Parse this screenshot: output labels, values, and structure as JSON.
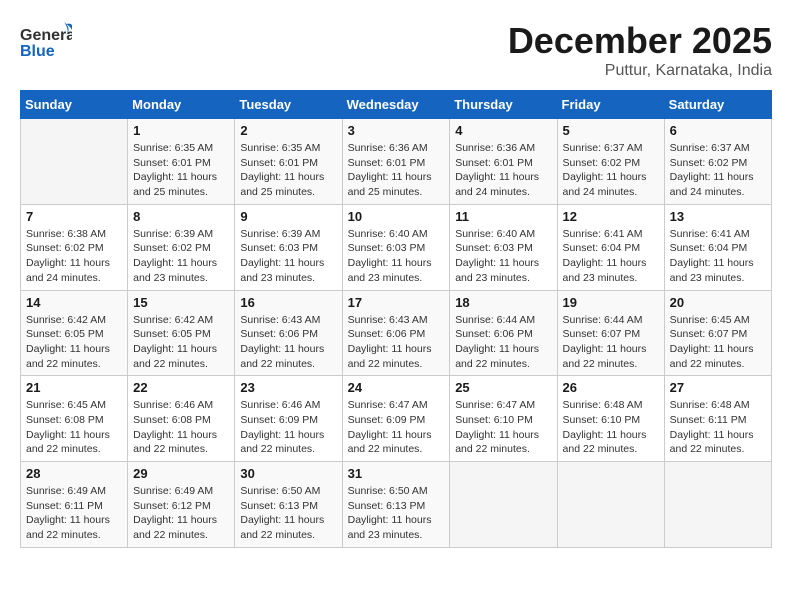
{
  "header": {
    "logo_general": "General",
    "logo_blue": "Blue",
    "month": "December 2025",
    "location": "Puttur, Karnataka, India"
  },
  "calendar": {
    "days_of_week": [
      "Sunday",
      "Monday",
      "Tuesday",
      "Wednesday",
      "Thursday",
      "Friday",
      "Saturday"
    ],
    "weeks": [
      [
        {
          "day": "",
          "info": ""
        },
        {
          "day": "1",
          "info": "Sunrise: 6:35 AM\nSunset: 6:01 PM\nDaylight: 11 hours\nand 25 minutes."
        },
        {
          "day": "2",
          "info": "Sunrise: 6:35 AM\nSunset: 6:01 PM\nDaylight: 11 hours\nand 25 minutes."
        },
        {
          "day": "3",
          "info": "Sunrise: 6:36 AM\nSunset: 6:01 PM\nDaylight: 11 hours\nand 25 minutes."
        },
        {
          "day": "4",
          "info": "Sunrise: 6:36 AM\nSunset: 6:01 PM\nDaylight: 11 hours\nand 24 minutes."
        },
        {
          "day": "5",
          "info": "Sunrise: 6:37 AM\nSunset: 6:02 PM\nDaylight: 11 hours\nand 24 minutes."
        },
        {
          "day": "6",
          "info": "Sunrise: 6:37 AM\nSunset: 6:02 PM\nDaylight: 11 hours\nand 24 minutes."
        }
      ],
      [
        {
          "day": "7",
          "info": "Sunrise: 6:38 AM\nSunset: 6:02 PM\nDaylight: 11 hours\nand 24 minutes."
        },
        {
          "day": "8",
          "info": "Sunrise: 6:39 AM\nSunset: 6:02 PM\nDaylight: 11 hours\nand 23 minutes."
        },
        {
          "day": "9",
          "info": "Sunrise: 6:39 AM\nSunset: 6:03 PM\nDaylight: 11 hours\nand 23 minutes."
        },
        {
          "day": "10",
          "info": "Sunrise: 6:40 AM\nSunset: 6:03 PM\nDaylight: 11 hours\nand 23 minutes."
        },
        {
          "day": "11",
          "info": "Sunrise: 6:40 AM\nSunset: 6:03 PM\nDaylight: 11 hours\nand 23 minutes."
        },
        {
          "day": "12",
          "info": "Sunrise: 6:41 AM\nSunset: 6:04 PM\nDaylight: 11 hours\nand 23 minutes."
        },
        {
          "day": "13",
          "info": "Sunrise: 6:41 AM\nSunset: 6:04 PM\nDaylight: 11 hours\nand 23 minutes."
        }
      ],
      [
        {
          "day": "14",
          "info": "Sunrise: 6:42 AM\nSunset: 6:05 PM\nDaylight: 11 hours\nand 22 minutes."
        },
        {
          "day": "15",
          "info": "Sunrise: 6:42 AM\nSunset: 6:05 PM\nDaylight: 11 hours\nand 22 minutes."
        },
        {
          "day": "16",
          "info": "Sunrise: 6:43 AM\nSunset: 6:06 PM\nDaylight: 11 hours\nand 22 minutes."
        },
        {
          "day": "17",
          "info": "Sunrise: 6:43 AM\nSunset: 6:06 PM\nDaylight: 11 hours\nand 22 minutes."
        },
        {
          "day": "18",
          "info": "Sunrise: 6:44 AM\nSunset: 6:06 PM\nDaylight: 11 hours\nand 22 minutes."
        },
        {
          "day": "19",
          "info": "Sunrise: 6:44 AM\nSunset: 6:07 PM\nDaylight: 11 hours\nand 22 minutes."
        },
        {
          "day": "20",
          "info": "Sunrise: 6:45 AM\nSunset: 6:07 PM\nDaylight: 11 hours\nand 22 minutes."
        }
      ],
      [
        {
          "day": "21",
          "info": "Sunrise: 6:45 AM\nSunset: 6:08 PM\nDaylight: 11 hours\nand 22 minutes."
        },
        {
          "day": "22",
          "info": "Sunrise: 6:46 AM\nSunset: 6:08 PM\nDaylight: 11 hours\nand 22 minutes."
        },
        {
          "day": "23",
          "info": "Sunrise: 6:46 AM\nSunset: 6:09 PM\nDaylight: 11 hours\nand 22 minutes."
        },
        {
          "day": "24",
          "info": "Sunrise: 6:47 AM\nSunset: 6:09 PM\nDaylight: 11 hours\nand 22 minutes."
        },
        {
          "day": "25",
          "info": "Sunrise: 6:47 AM\nSunset: 6:10 PM\nDaylight: 11 hours\nand 22 minutes."
        },
        {
          "day": "26",
          "info": "Sunrise: 6:48 AM\nSunset: 6:10 PM\nDaylight: 11 hours\nand 22 minutes."
        },
        {
          "day": "27",
          "info": "Sunrise: 6:48 AM\nSunset: 6:11 PM\nDaylight: 11 hours\nand 22 minutes."
        }
      ],
      [
        {
          "day": "28",
          "info": "Sunrise: 6:49 AM\nSunset: 6:11 PM\nDaylight: 11 hours\nand 22 minutes."
        },
        {
          "day": "29",
          "info": "Sunrise: 6:49 AM\nSunset: 6:12 PM\nDaylight: 11 hours\nand 22 minutes."
        },
        {
          "day": "30",
          "info": "Sunrise: 6:50 AM\nSunset: 6:13 PM\nDaylight: 11 hours\nand 22 minutes."
        },
        {
          "day": "31",
          "info": "Sunrise: 6:50 AM\nSunset: 6:13 PM\nDaylight: 11 hours\nand 23 minutes."
        },
        {
          "day": "",
          "info": ""
        },
        {
          "day": "",
          "info": ""
        },
        {
          "day": "",
          "info": ""
        }
      ]
    ]
  }
}
